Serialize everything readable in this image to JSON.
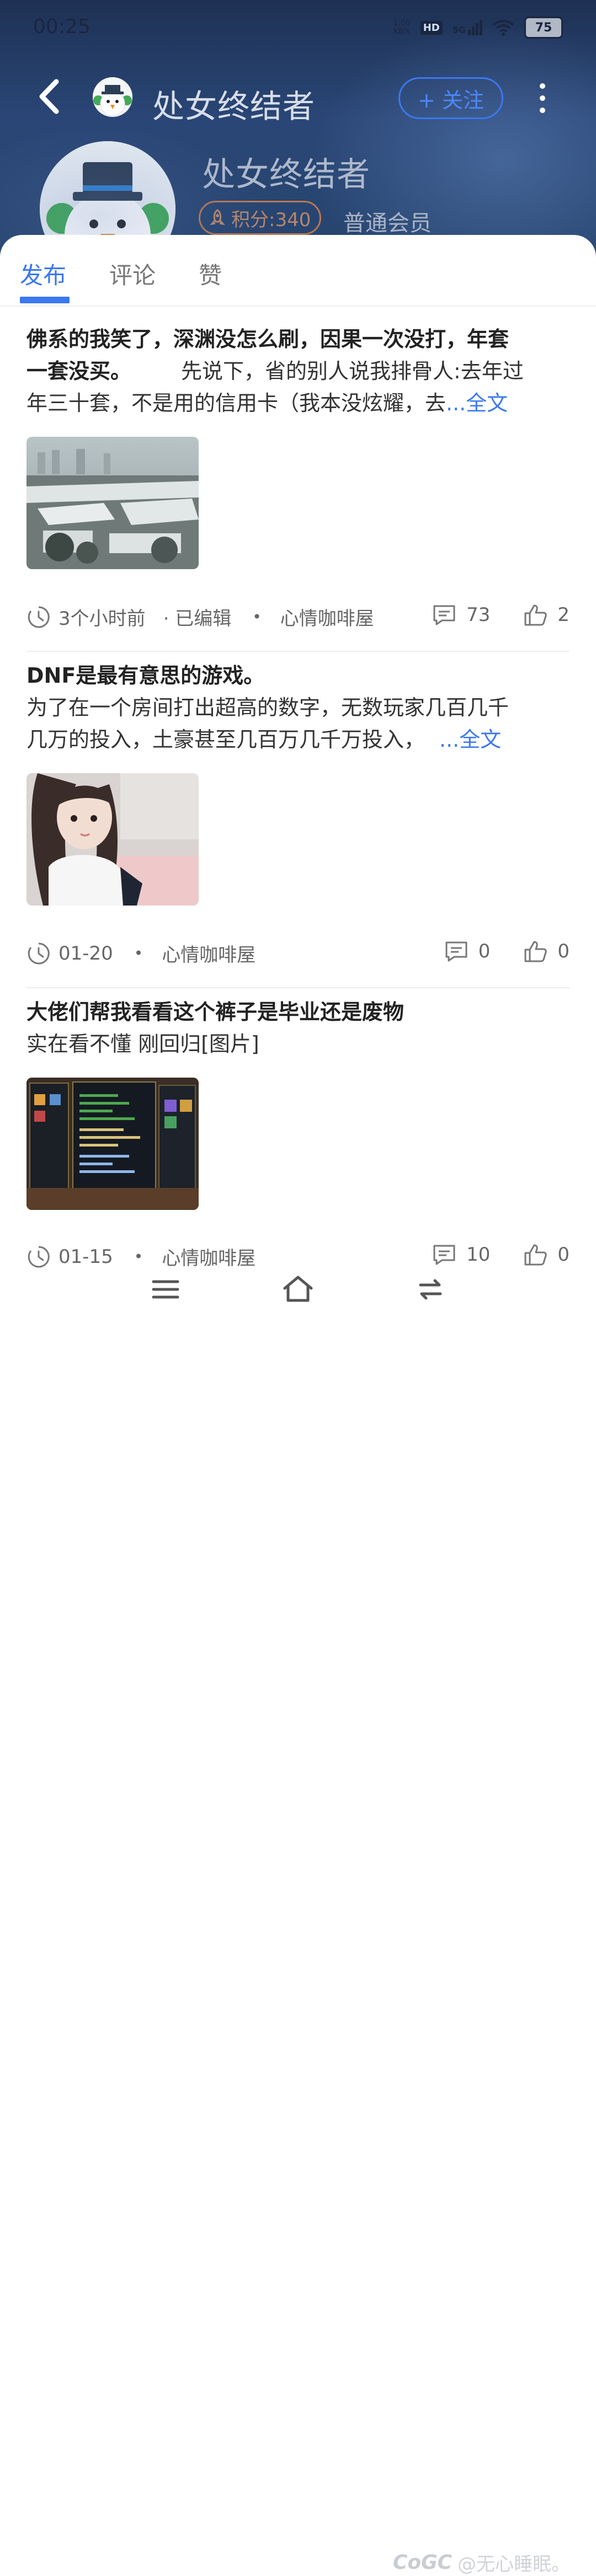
{
  "status_bar": {
    "time": "00:25",
    "net_speed_value": "1.00",
    "net_speed_unit": "KB/s",
    "hd": "HD",
    "signal": "5G",
    "battery": "75"
  },
  "header": {
    "title": "处女终结者",
    "follow_label": "+ 关注",
    "profile_name": "处女终结者",
    "points_label": "积分:340",
    "member_level": "普通会员"
  },
  "tabs": [
    {
      "label": "发布",
      "active": true
    },
    {
      "label": "评论",
      "active": false
    },
    {
      "label": "赞",
      "active": false
    }
  ],
  "posts": [
    {
      "title_line1": "佛系的我笑了，深渊没怎么刷，因果一次没打，年套",
      "title_line2": "一套没买。",
      "body_inline": "先说下，省的别人说我排骨人:去年过",
      "body_line2": "年三十套，不是用的信用卡（我本没炫耀，去",
      "more": "...全文",
      "time": "3个小时前",
      "edited": "· 已编辑",
      "forum": "心情咖啡屋",
      "comments": "73",
      "likes": "2"
    },
    {
      "title": "DNF是最有意思的游戏。",
      "body_line1": "为了在一个房间打出超高的数字，无数玩家几百几千",
      "body_line2": "几万的投入，土豪甚至几百万几千万投入，",
      "more": "...全文",
      "time": "01-20",
      "forum": "心情咖啡屋",
      "comments": "0",
      "likes": "0"
    },
    {
      "title": "大佬们帮我看看这个裤子是毕业还是废物",
      "body_line1": "实在看不懂 刚回归[图片]",
      "time": "01-15",
      "forum": "心情咖啡屋",
      "comments": "10",
      "likes": "0"
    }
  ],
  "meta_dot": "•",
  "watermark": {
    "brand": "CoGC",
    "user": "@无心睡眠。"
  },
  "colors": {
    "accent": "#3b78f0",
    "header_bg": "#27456f",
    "badge": "#b9774f"
  }
}
